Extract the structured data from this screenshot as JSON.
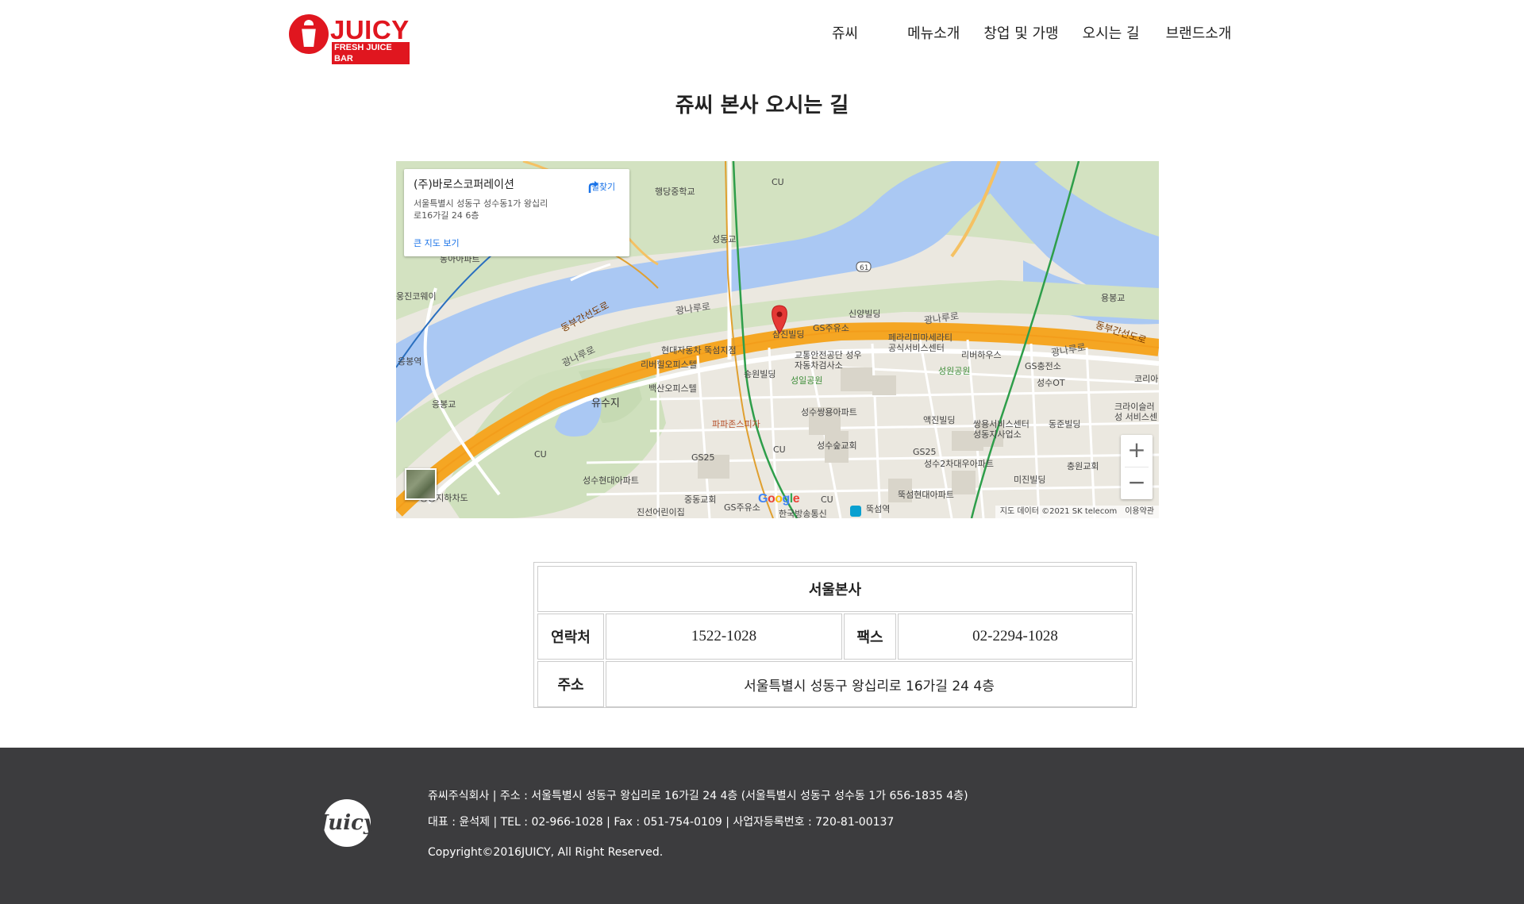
{
  "header": {
    "logo": {
      "brand": "JUICY",
      "tagline": "FRESH JUICE BAR",
      "color": "#e0161f"
    },
    "nav": [
      "쥬씨",
      "메뉴소개",
      "창업 및 가맹",
      "오시는 길",
      "브랜드소개"
    ]
  },
  "page_title": "쥬씨 본사 오시는 길",
  "map": {
    "info_card": {
      "name": "(주)바로스코퍼레이션",
      "address": "서울특별시 성동구 성수동1가 왕십리로16가길 24 6층",
      "directions_label": "길찾기",
      "larger_map_link": "큰 지도 보기"
    },
    "marker_label": "삼진빌딩",
    "labels": {
      "haengdang_ms": "행당중학교",
      "seongdonggyo": "성동교",
      "dongbu_1": "동부간선도로",
      "dongbu_2": "동부간선도로",
      "gwangna_1": "광나루로",
      "gwangna_2": "광나루로",
      "gwangna_3": "광나루로",
      "gwangna_4": "광나루로",
      "hyundai": "현대자동차 뚝섬지점",
      "riverhill": "리버힐오피스텔",
      "baeksan": "백산오피스텔",
      "yusuji": "유수지",
      "pajeon": "파파존스피자",
      "gs25_1": "GS25",
      "gs25_2": "GS25",
      "seongsu_hyundai": "성수현대아파트",
      "jungdong": "중동교회",
      "jinseon": "진선어린이집",
      "gsgas": "GS주유소",
      "broadcast": "한국방송통신",
      "ttukseom": "뚝섬역",
      "songwon": "송원빌딩",
      "seongil": "성일공원",
      "traffic": "교통안전공단 성우 자동차검사소",
      "seongsu_ssangyong": "성수쌍용아파트",
      "seongsu_church": "성수숲교회",
      "gs_gas2": "GS주유소",
      "sinyang": "신양빌딩",
      "ferrari": "페라리피마세라티 공식서비스센터",
      "riverhouse": "리버하우스",
      "seongwon": "성원공원",
      "gs_charge": "GS충전소",
      "seongsu_ot": "성수OT",
      "aekjin": "액진빌딩",
      "ssangyong_sc": "쌍용서비스센터 성동지사업소",
      "seongsu2": "성수2차대우아파트",
      "mijin": "미진빌딩",
      "dongjun": "동준빌딩",
      "chungwon": "충원교회",
      "seongsu_hyundai2": "뚝섬현대아파트",
      "yongbonggyo": "용봉교",
      "yongbong_st": "응봉역",
      "yongbong_tunnel": "응봉지하차도",
      "eungbong": "응봉교",
      "korea": "코리아빌",
      "krysler": "크라이슬러 성 서비스센",
      "yongjin": "웅진코웨이",
      "dongmyeon": "동아아파트",
      "cu_label": "CU",
      "road_61": "61"
    },
    "google": [
      "G",
      "o",
      "o",
      "g",
      "l",
      "e"
    ],
    "google_colors": [
      "#4285f4",
      "#ea4335",
      "#fbbc05",
      "#4285f4",
      "#34a853",
      "#ea4335"
    ],
    "attribution": "지도 데이터 ©2021 SK telecom",
    "terms": "이용약관",
    "zoom_in": "+",
    "zoom_out": "−"
  },
  "office_table": {
    "title": "서울본사",
    "contact_label": "연락처",
    "contact_value": "1522-1028",
    "fax_label": "팩스",
    "fax_value": "02-2294-1028",
    "address_label": "주소",
    "address_value": "서울특별시 성동구 왕십리로 16가길 24 4층"
  },
  "footer": {
    "logo_text": "Juicy",
    "line1": "쥬씨주식회사 | 주소 : 서울특별시 성동구 왕십리로 16가길 24 4층 (서울특별시 성동구 성수동 1가 656-1835 4층)",
    "line2": "대표 : 윤석제 | TEL : 02-966-1028 | Fax : 051-754-0109 | 사업자등록번호 : 720-81-00137",
    "line3": "Copyright©2016JUICY, All Right Reserved."
  }
}
